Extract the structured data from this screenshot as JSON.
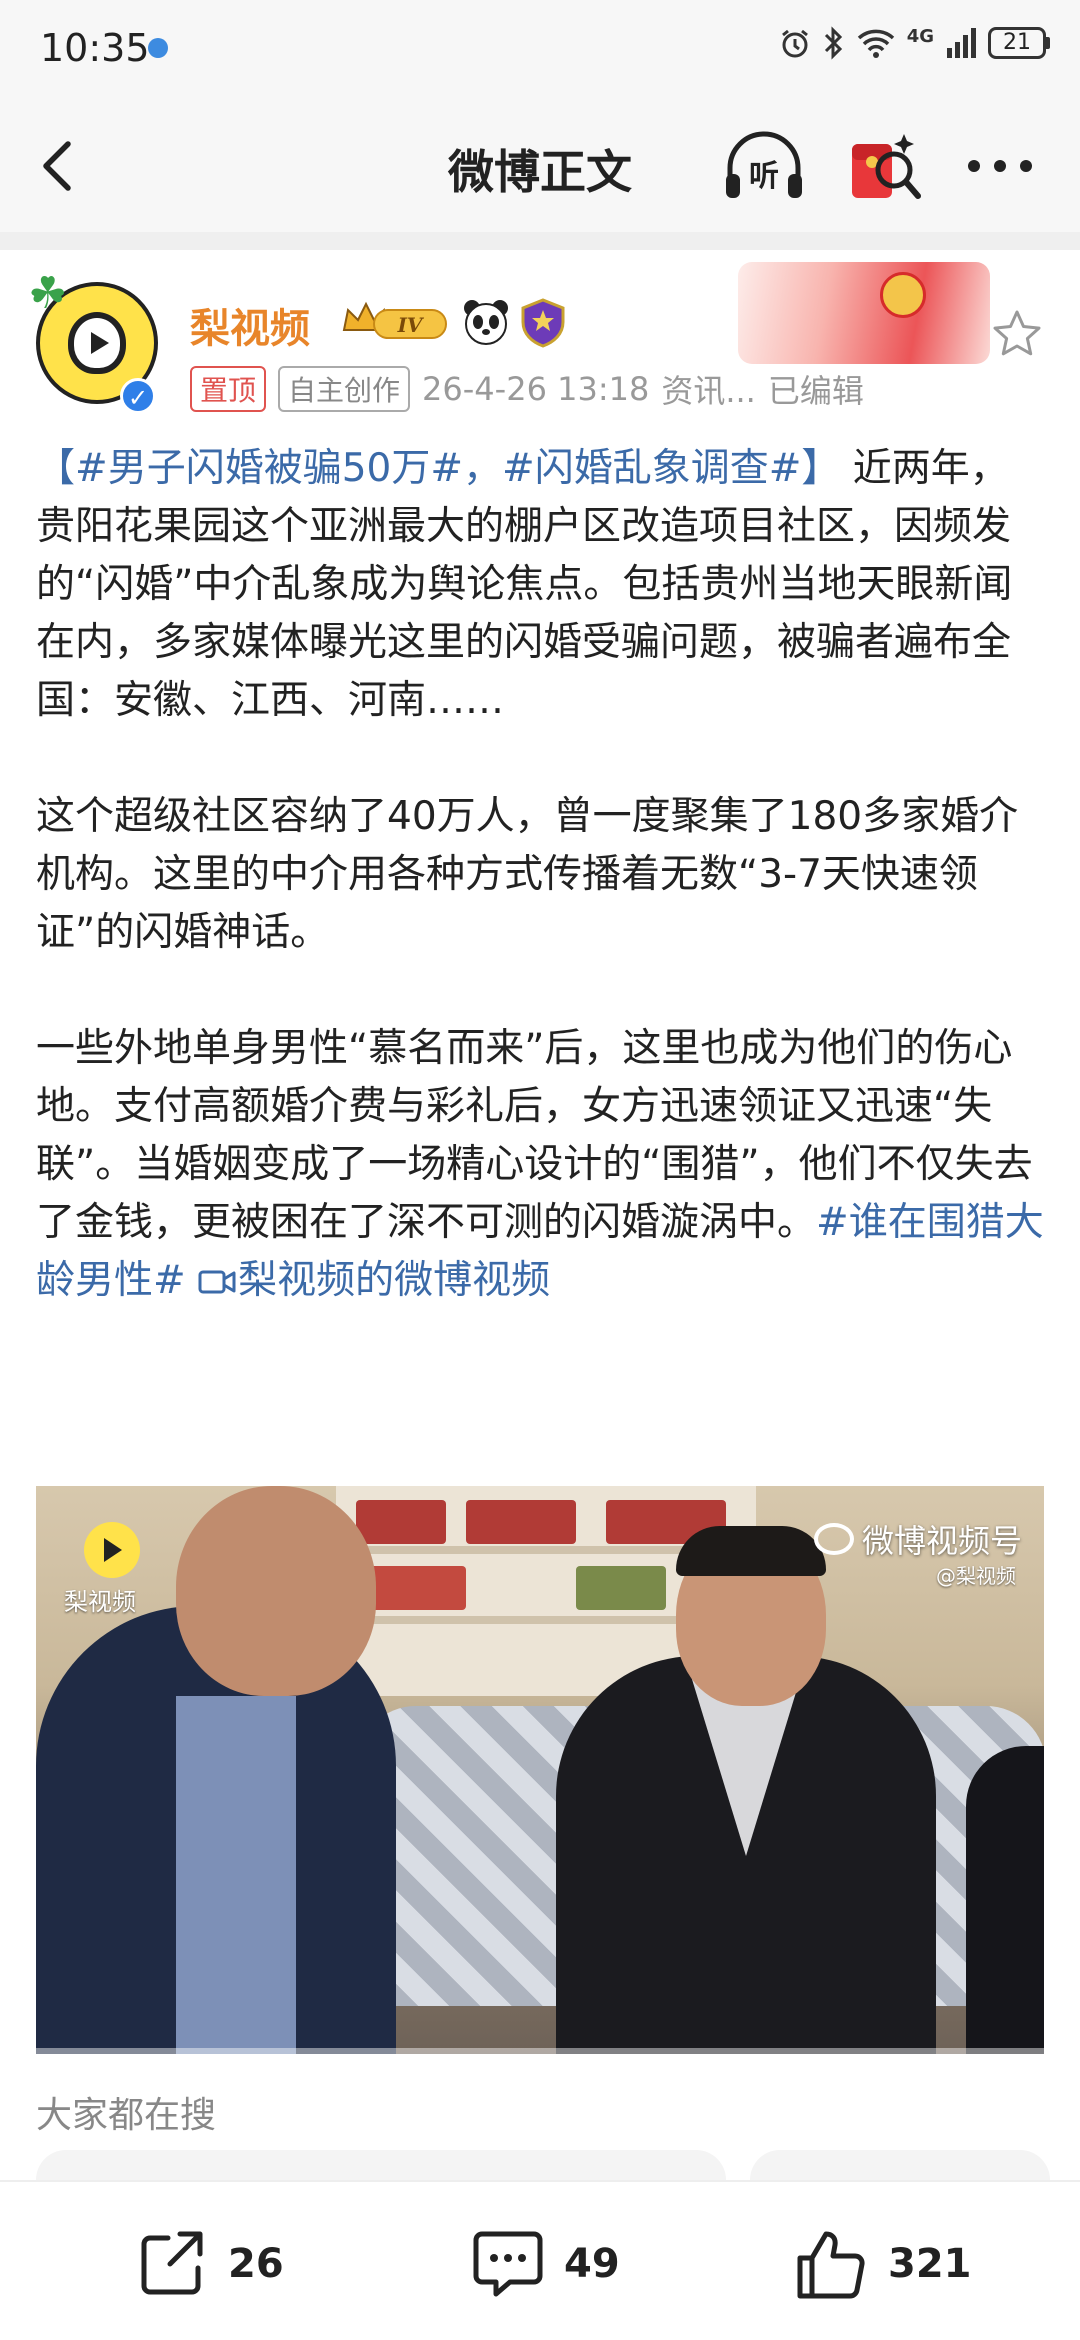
{
  "status_bar": {
    "time": "10:35",
    "network": "4G",
    "battery": "21"
  },
  "nav": {
    "title": "微博正文",
    "listen_label": "听"
  },
  "post": {
    "author": "梨视频",
    "vip_level": "IV",
    "pinned_tag": "置顶",
    "original_tag": "自主创作",
    "timestamp": "26-4-26 13:18",
    "category": "资讯...",
    "edited": "已编辑",
    "p1_bracket_open": "【",
    "p1_hashtag1": "#男子闪婚被骗50万#",
    "p1_sep": "，",
    "p1_hashtag2": "#闪婚乱象调查#",
    "p1_bracket_close": "】",
    "p1_text": " 近两年，贵阳花果园这个亚洲最大的棚户区改造项目社区，因频发的“闪婚”中介乱象成为舆论焦点。包括贵州当地天眼新闻在内，多家媒体曝光这里的闪婚受骗问题，被骗者遍布全国：安徽、江西、河南……",
    "p2_text": "这个超级社区容纳了40万人，曾一度聚集了180多家婚介机构。这里的中介用各种方式传播着无数“3-7天快速领证”的闪婚神话。",
    "p3_text": "一些外地单身男性“慕名而来”后，这里也成为他们的伤心地。支付高额婚介费与彩礼后，女方迅速领证又迅速“失联”。当婚姻变成了一场精心设计的“围猎”，他们不仅失去了金钱，更被困在了深不可测的闪婚漩涡中。",
    "p3_hashtag": "#谁在围猎大龄男性#",
    "video_link": "梨视频的微博视频"
  },
  "video": {
    "logo_text": "梨视频",
    "watermark": "微博视频号",
    "watermark_sub": "@梨视频"
  },
  "trending": {
    "title": "大家都在搜"
  },
  "actions": {
    "repost_count": "26",
    "comment_count": "49",
    "like_count": "321"
  },
  "colors": {
    "username": "#e8852a",
    "hashtag": "#3b6aa8",
    "pinned": "#e0534f",
    "verified": "#2f7fe8"
  }
}
